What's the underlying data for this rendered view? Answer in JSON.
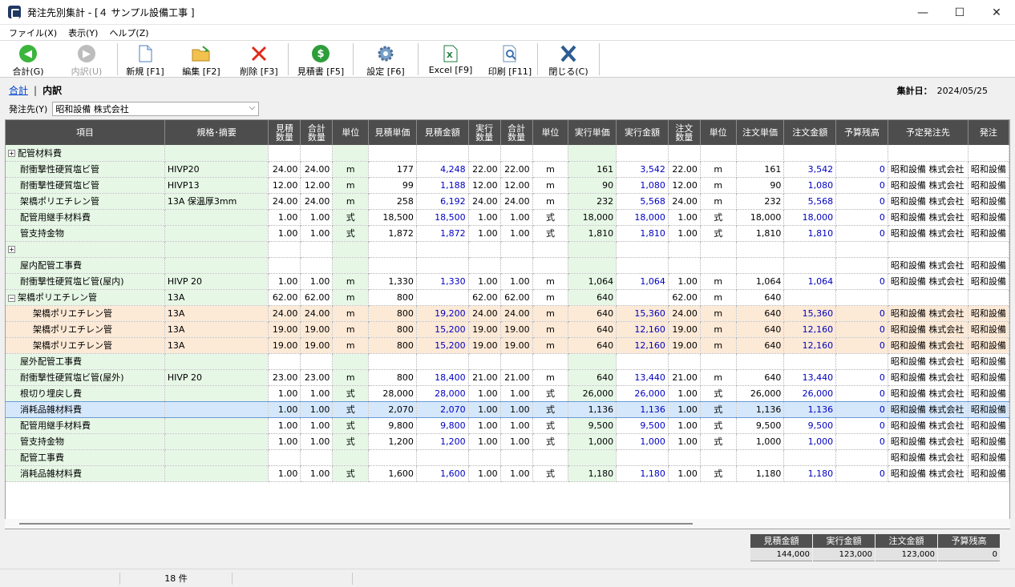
{
  "window": {
    "title": "発注先別集計 - [４ サンプル設備工事 ]",
    "min": "—",
    "max": "☐",
    "close": "✕"
  },
  "menu": [
    "ファイル(X)",
    "表示(Y)",
    "ヘルプ(Z)"
  ],
  "toolbar": [
    {
      "id": "goukei",
      "label": "合計(G)",
      "icon": "arrow-left",
      "color": "#3bb53b",
      "disabled": false
    },
    {
      "id": "uchiwake",
      "label": "内訳(U)",
      "icon": "arrow-right",
      "color": "#bdbdbd",
      "disabled": true
    },
    {
      "sep": true
    },
    {
      "id": "new",
      "label": "新規 [F1]",
      "icon": "page"
    },
    {
      "id": "edit",
      "label": "編集 [F2]",
      "icon": "folder"
    },
    {
      "id": "delete",
      "label": "削除 [F3]",
      "icon": "x-red"
    },
    {
      "sep": true
    },
    {
      "id": "estimate",
      "label": "見積書 [F5]",
      "icon": "dollar"
    },
    {
      "sep": true
    },
    {
      "id": "settings",
      "label": "設定 [F6]",
      "icon": "gear"
    },
    {
      "sep": true
    },
    {
      "id": "excel",
      "label": "Excel [F9]",
      "icon": "excel"
    },
    {
      "id": "print",
      "label": "印刷 [F11]",
      "icon": "print"
    },
    {
      "sep": true
    },
    {
      "id": "close",
      "label": "閉じる(C)",
      "icon": "x-blue"
    },
    {
      "sep": true
    }
  ],
  "breadcrumb": {
    "link": "合計",
    "current": "内訳"
  },
  "summary_date": {
    "label": "集計日：",
    "value": "2024/05/25"
  },
  "vendor": {
    "label": "発注先(Y)",
    "value": "昭和設備 株式会社"
  },
  "columns": [
    "項目",
    "規格･摘要",
    "見積\n数量",
    "合計\n数量",
    "単位",
    "見積単価",
    "見積金額",
    "実行\n数量",
    "合計\n数量",
    "単位",
    "実行単価",
    "実行金額",
    "注文\n数量",
    "単位",
    "注文単価",
    "注文金額",
    "予算残高",
    "予定発注先",
    "発注"
  ],
  "rows": [
    {
      "type": "group",
      "expander": "+",
      "c": [
        "配管材料費",
        "",
        "",
        "",
        "",
        "",
        "",
        "",
        "",
        "",
        "",
        "",
        "",
        "",
        "",
        "",
        "",
        "",
        ""
      ]
    },
    {
      "c": [
        "耐衝撃性硬質塩ビ管",
        "HIVP20",
        "24.00",
        "24.00",
        "m",
        "177",
        "4,248",
        "22.00",
        "22.00",
        "m",
        "161",
        "3,542",
        "22.00",
        "m",
        "161",
        "3,542",
        "0",
        "昭和設備 株式会社",
        "昭和設備"
      ]
    },
    {
      "c": [
        "耐衝撃性硬質塩ビ管",
        "HIVP13",
        "12.00",
        "12.00",
        "m",
        "99",
        "1,188",
        "12.00",
        "12.00",
        "m",
        "90",
        "1,080",
        "12.00",
        "m",
        "90",
        "1,080",
        "0",
        "昭和設備 株式会社",
        "昭和設備"
      ]
    },
    {
      "c": [
        "架橋ポリエチレン管",
        "13A 保温厚3mm",
        "24.00",
        "24.00",
        "m",
        "258",
        "6,192",
        "24.00",
        "24.00",
        "m",
        "232",
        "5,568",
        "24.00",
        "m",
        "232",
        "5,568",
        "0",
        "昭和設備 株式会社",
        "昭和設備"
      ]
    },
    {
      "c": [
        "配管用継手材料費",
        "",
        "1.00",
        "1.00",
        "式",
        "18,500",
        "18,500",
        "1.00",
        "1.00",
        "式",
        "18,000",
        "18,000",
        "1.00",
        "式",
        "18,000",
        "18,000",
        "0",
        "昭和設備 株式会社",
        "昭和設備"
      ]
    },
    {
      "c": [
        "管支持金物",
        "",
        "1.00",
        "1.00",
        "式",
        "1,872",
        "1,872",
        "1.00",
        "1.00",
        "式",
        "1,810",
        "1,810",
        "1.00",
        "式",
        "1,810",
        "1,810",
        "0",
        "昭和設備 株式会社",
        "昭和設備"
      ]
    },
    {
      "type": "group",
      "expander": "+",
      "c": [
        "",
        "",
        "",
        "",
        "",
        "",
        "",
        "",
        "",
        "",
        "",
        "",
        "",
        "",
        "",
        "",
        "",
        "",
        ""
      ]
    },
    {
      "c": [
        "屋内配管工事費",
        "",
        "",
        "",
        "",
        "",
        "",
        "",
        "",
        "",
        "",
        "",
        "",
        "",
        "",
        "",
        "",
        "昭和設備 株式会社",
        "昭和設備"
      ]
    },
    {
      "c": [
        "耐衝撃性硬質塩ビ管(屋内)",
        "HIVP 20",
        "1.00",
        "1.00",
        "m",
        "1,330",
        "1,330",
        "1.00",
        "1.00",
        "m",
        "1,064",
        "1,064",
        "1.00",
        "m",
        "1,064",
        "1,064",
        "0",
        "昭和設備 株式会社",
        "昭和設備"
      ]
    },
    {
      "type": "group",
      "expander": "−",
      "c": [
        "架橋ポリエチレン管",
        "13A",
        "62.00",
        "62.00",
        "m",
        "800",
        "",
        "62.00",
        "62.00",
        "m",
        "640",
        "",
        "62.00",
        "m",
        "640",
        "",
        "",
        "",
        ""
      ]
    },
    {
      "type": "sub",
      "c": [
        "架橋ポリエチレン管",
        "13A",
        "24.00",
        "24.00",
        "m",
        "800",
        "19,200",
        "24.00",
        "24.00",
        "m",
        "640",
        "15,360",
        "24.00",
        "m",
        "640",
        "15,360",
        "0",
        "昭和設備 株式会社",
        "昭和設備"
      ]
    },
    {
      "type": "sub",
      "c": [
        "架橋ポリエチレン管",
        "13A",
        "19.00",
        "19.00",
        "m",
        "800",
        "15,200",
        "19.00",
        "19.00",
        "m",
        "640",
        "12,160",
        "19.00",
        "m",
        "640",
        "12,160",
        "0",
        "昭和設備 株式会社",
        "昭和設備"
      ]
    },
    {
      "type": "sub",
      "c": [
        "架橋ポリエチレン管",
        "13A",
        "19.00",
        "19.00",
        "m",
        "800",
        "15,200",
        "19.00",
        "19.00",
        "m",
        "640",
        "12,160",
        "19.00",
        "m",
        "640",
        "12,160",
        "0",
        "昭和設備 株式会社",
        "昭和設備"
      ]
    },
    {
      "c": [
        "屋外配管工事費",
        "",
        "",
        "",
        "",
        "",
        "",
        "",
        "",
        "",
        "",
        "",
        "",
        "",
        "",
        "",
        "",
        "昭和設備 株式会社",
        "昭和設備"
      ]
    },
    {
      "c": [
        "耐衝撃性硬質塩ビ管(屋外)",
        "HIVP 20",
        "23.00",
        "23.00",
        "m",
        "800",
        "18,400",
        "21.00",
        "21.00",
        "m",
        "640",
        "13,440",
        "21.00",
        "m",
        "640",
        "13,440",
        "0",
        "昭和設備 株式会社",
        "昭和設備"
      ]
    },
    {
      "c": [
        "根切り埋戻し費",
        "",
        "1.00",
        "1.00",
        "式",
        "28,000",
        "28,000",
        "1.00",
        "1.00",
        "式",
        "26,000",
        "26,000",
        "1.00",
        "式",
        "26,000",
        "26,000",
        "0",
        "昭和設備 株式会社",
        "昭和設備"
      ]
    },
    {
      "type": "sel",
      "c": [
        "消耗品雑材料費",
        "",
        "1.00",
        "1.00",
        "式",
        "2,070",
        "2,070",
        "1.00",
        "1.00",
        "式",
        "1,136",
        "1,136",
        "1.00",
        "式",
        "1,136",
        "1,136",
        "0",
        "昭和設備 株式会社",
        "昭和設備"
      ]
    },
    {
      "c": [
        "配管用継手材料費",
        "",
        "1.00",
        "1.00",
        "式",
        "9,800",
        "9,800",
        "1.00",
        "1.00",
        "式",
        "9,500",
        "9,500",
        "1.00",
        "式",
        "9,500",
        "9,500",
        "0",
        "昭和設備 株式会社",
        "昭和設備"
      ]
    },
    {
      "c": [
        "管支持金物",
        "",
        "1.00",
        "1.00",
        "式",
        "1,200",
        "1,200",
        "1.00",
        "1.00",
        "式",
        "1,000",
        "1,000",
        "1.00",
        "式",
        "1,000",
        "1,000",
        "0",
        "昭和設備 株式会社",
        "昭和設備"
      ]
    },
    {
      "c": [
        "配管工事費",
        "",
        "",
        "",
        "",
        "",
        "",
        "",
        "",
        "",
        "",
        "",
        "",
        "",
        "",
        "",
        "",
        "昭和設備 株式会社",
        "昭和設備"
      ]
    },
    {
      "c": [
        "消耗品雑材料費",
        "",
        "1.00",
        "1.00",
        "式",
        "1,600",
        "1,600",
        "1.00",
        "1.00",
        "式",
        "1,180",
        "1,180",
        "1.00",
        "式",
        "1,180",
        "1,180",
        "0",
        "昭和設備 株式会社",
        "昭和設備"
      ]
    }
  ],
  "totals": [
    {
      "label": "見積金額",
      "value": "144,000"
    },
    {
      "label": "実行金額",
      "value": "123,000"
    },
    {
      "label": "注文金額",
      "value": "123,000"
    },
    {
      "label": "予算残高",
      "value": "0"
    }
  ],
  "status": {
    "count": "18 件"
  }
}
